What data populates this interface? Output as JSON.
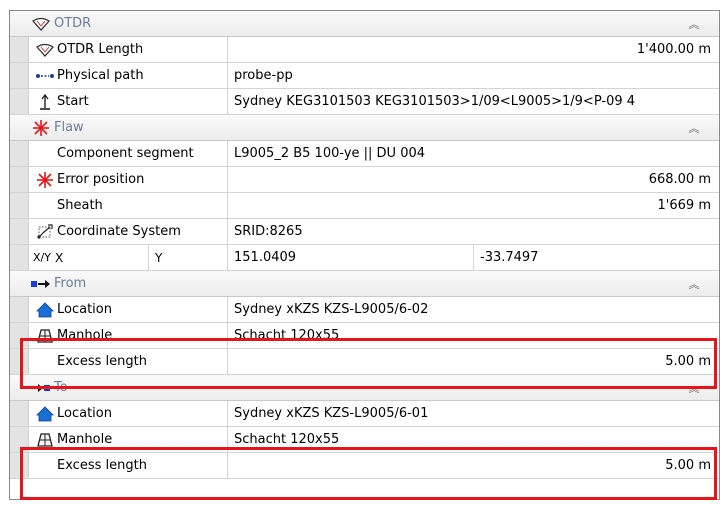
{
  "sections": {
    "otdr": {
      "title": "OTDR",
      "rows": {
        "length": {
          "label": "OTDR Length",
          "value": "1'400.00 m"
        },
        "path": {
          "label": "Physical path",
          "value": "probe-pp"
        },
        "start": {
          "label": "Start",
          "value": "Sydney KEG3101503 KEG3101503>1/09<L9005>1/9<P-09 4"
        }
      }
    },
    "flaw": {
      "title": "Flaw",
      "rows": {
        "segment": {
          "label": "Component segment",
          "value": "L9005_2 B5 100-ye || DU 004"
        },
        "error": {
          "label": "Error position",
          "value": "668.00 m"
        },
        "sheath": {
          "label": "Sheath",
          "value": "1'669 m"
        },
        "coord": {
          "label": "Coordinate System",
          "value": "SRID:8265"
        },
        "xy": {
          "prefix": "X/Y",
          "x_label": "X",
          "y_label": "Y",
          "x_value": "151.0409",
          "y_value": "-33.7497"
        }
      }
    },
    "from": {
      "title": "From",
      "rows": {
        "location": {
          "label": "Location",
          "value": "Sydney xKZS KZS-L9005/6-02"
        },
        "manhole": {
          "label": "Manhole",
          "value": "Schacht 120x55"
        },
        "excess": {
          "label": "Excess length",
          "value": "5.00 m"
        }
      }
    },
    "to": {
      "title": "To",
      "rows": {
        "location": {
          "label": "Location",
          "value": "Sydney xKZS KZS-L9005/6-01"
        },
        "manhole": {
          "label": "Manhole",
          "value": "Schacht 120x55"
        },
        "excess": {
          "label": "Excess length",
          "value": "5.00 m"
        }
      }
    }
  },
  "collapse_glyph": "‸",
  "colors": {
    "highlight": "#e8141b",
    "header_text": "#6b7d9b",
    "flaw_icon": "#e8141b",
    "location_icon": "#1a6fd6"
  }
}
